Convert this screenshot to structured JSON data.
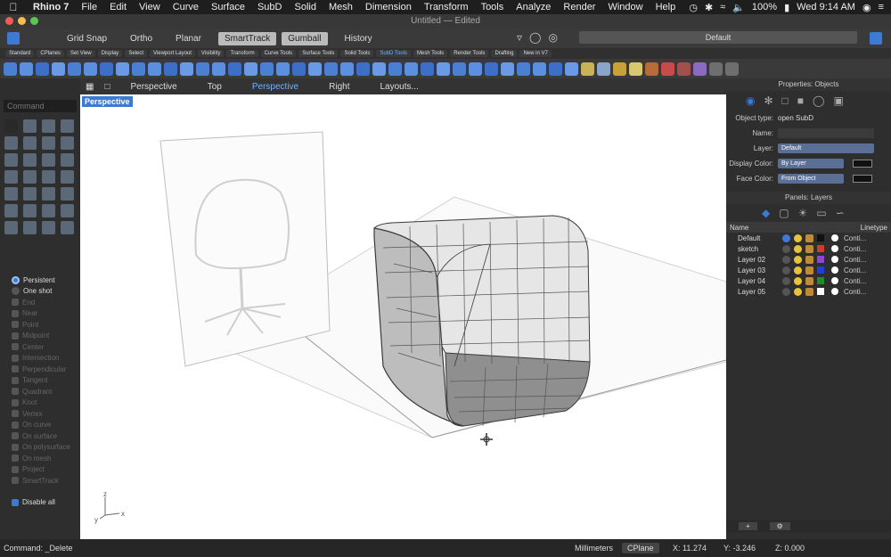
{
  "menubar": {
    "app": "Rhino 7",
    "items": [
      "File",
      "Edit",
      "View",
      "Curve",
      "Surface",
      "SubD",
      "Solid",
      "Mesh",
      "Dimension",
      "Transform",
      "Tools",
      "Analyze",
      "Render",
      "Window",
      "Help"
    ],
    "battery": "100%",
    "clock": "Wed 9:14 AM"
  },
  "window": {
    "title": "Untitled — Edited"
  },
  "toolbar": {
    "grid_snap": "Grid Snap",
    "ortho": "Ortho",
    "planar": "Planar",
    "smarttrack": "SmartTrack",
    "gumball": "Gumball",
    "history": "History",
    "layer": "Default"
  },
  "tabs": [
    "Standard",
    "CPlanes",
    "Set View",
    "Display",
    "Select",
    "Viewport Layout",
    "Visibility",
    "Transform",
    "Curve Tools",
    "Surface Tools",
    "Solid Tools",
    "SubD Tools",
    "Mesh Tools",
    "Render Tools",
    "Drafting",
    "New in V7"
  ],
  "active_tab": "SubD Tools",
  "command": {
    "placeholder": "Command"
  },
  "osnap": {
    "mode_persistent": "Persistent",
    "mode_oneshot": "One shot",
    "items": [
      "End",
      "Near",
      "Point",
      "Midpoint",
      "Center",
      "Intersection",
      "Perpendicular",
      "Tangent",
      "Quadrant",
      "Knot",
      "Vertex",
      "On curve",
      "On surface",
      "On polysurface",
      "On mesh",
      "Project",
      "SmartTrack"
    ],
    "disable_all": "Disable all"
  },
  "viewport_tabs": [
    "Perspective",
    "Top",
    "Perspective",
    "Right",
    "Layouts..."
  ],
  "viewport_label": "Perspective",
  "axis": {
    "x": "x",
    "y": "y",
    "z": "z"
  },
  "properties": {
    "header": "Properties: Objects",
    "object_type_label": "Object type:",
    "object_type_value": "open SubD",
    "name_label": "Name:",
    "layer_label": "Layer:",
    "layer_value": "Default",
    "display_color_label": "Display Color:",
    "display_color_value": "By Layer",
    "face_color_label": "Face Color:",
    "face_color_value": "From Object"
  },
  "layers_panel": {
    "header": "Panels: Layers",
    "col_name": "Name",
    "col_linetype": "Linetype",
    "rows": [
      {
        "name": "Default",
        "color": "#111111",
        "linetype": "Conti..."
      },
      {
        "name": "sketch",
        "color": "#111111",
        "linetype": "Conti..."
      },
      {
        "name": "Layer 02",
        "color": "#8e44d6",
        "linetype": "Conti..."
      },
      {
        "name": "Layer 03",
        "color": "#1f3fd6",
        "linetype": "Conti..."
      },
      {
        "name": "Layer 04",
        "color": "#1a8f2a",
        "linetype": "Conti..."
      },
      {
        "name": "Layer 05",
        "color": "#ffffff",
        "linetype": "Conti..."
      }
    ],
    "first_color": "#d23a2a"
  },
  "status": {
    "command": "Command: _Delete",
    "units": "Millimeters",
    "cplane": "CPlane",
    "x": "X: 11.274",
    "y": "Y: -3.246",
    "z": "Z: 0.000"
  }
}
